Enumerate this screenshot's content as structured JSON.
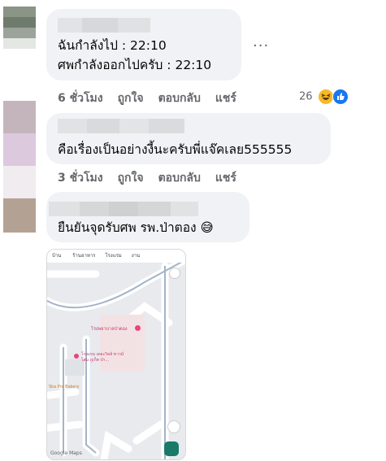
{
  "comments": [
    {
      "lines": [
        "ฉันกำลังไป : 22:10",
        "ศพกำลังออกไปครับ : 22:10"
      ],
      "time": "6 ชั่วโมง",
      "like": "ถูกใจ",
      "reply": "ตอบกลับ",
      "share": "แชร์",
      "more": "···",
      "reaction_count": "26"
    },
    {
      "lines": [
        "คือเรื่องเป็นอย่างงี้นะครับพี่แจ๊คเลย555555"
      ],
      "time": "3 ชั่วโมง",
      "like": "ถูกใจ",
      "reply": "ตอบกลับ",
      "share": "แชร์"
    },
    {
      "lines": [
        "ยืนยันจุดรับศพ รพ.ป่าตอง 😅"
      ]
    }
  ],
  "map": {
    "tabs": [
      "บ้าน",
      "ร้านอาหาร",
      "โรงแรม",
      "งาน"
    ],
    "place_main": "โรงพยาบาลป่าตอง",
    "place_sub": "โรงแรม เดอะวิลล์ ทาวน์โฮม ภูเก็ต ป่า...",
    "place_left": "Ska Pro Bakery",
    "logo": "Google Maps"
  },
  "colors": {
    "bubble": "#f0f2f5",
    "meta": "#65676b",
    "map_bg": "#e8eaed",
    "road": "#ffffff",
    "route": "#a3b4c8",
    "pin": "#e8457c",
    "nav": "#1a7a6a"
  }
}
